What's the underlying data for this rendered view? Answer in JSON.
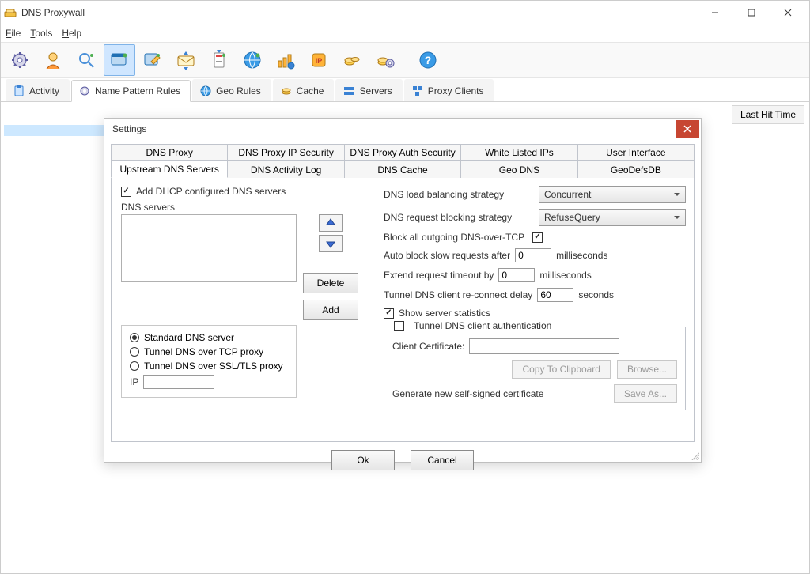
{
  "window": {
    "title": "DNS Proxywall",
    "minimize_icon": "minimize-icon",
    "maximize_icon": "maximize-icon",
    "close_icon": "close-icon"
  },
  "menubar": {
    "file": "File",
    "tools": "Tools",
    "help": "Help"
  },
  "main_tabs": {
    "activity": "Activity",
    "name_pattern_rules": "Name Pattern Rules",
    "geo_rules": "Geo Rules",
    "cache": "Cache",
    "servers": "Servers",
    "proxy_clients": "Proxy Clients"
  },
  "columns": {
    "last_hit_time": "Last Hit Time"
  },
  "dialog": {
    "title": "Settings",
    "tabs_row1": {
      "dns_proxy": "DNS Proxy",
      "dns_proxy_ip_sec": "DNS Proxy IP Security",
      "dns_proxy_auth_sec": "DNS Proxy Auth Security",
      "white_listed_ips": "White Listed IPs",
      "user_interface": "User Interface"
    },
    "tabs_row2": {
      "upstream": "Upstream DNS Servers",
      "activity_log": "DNS Activity Log",
      "dns_cache": "DNS Cache",
      "geo_dns": "Geo DNS",
      "geodefsdb": "GeoDefsDB"
    },
    "left": {
      "add_dhcp": "Add DHCP configured DNS servers",
      "dns_servers_label": "DNS servers",
      "delete": "Delete",
      "add": "Add",
      "radio_std": "Standard DNS server",
      "radio_tcp": "Tunnel DNS over TCP proxy",
      "radio_ssl": "Tunnel DNS over SSL/TLS proxy",
      "ip_label": "IP"
    },
    "right": {
      "load_bal_label": "DNS load balancing strategy",
      "load_bal_value": "Concurrent",
      "block_strat_label": "DNS request blocking strategy",
      "block_strat_value": "RefuseQuery",
      "block_tcp_label": "Block all outgoing DNS-over-TCP",
      "auto_block_label_pre": "Auto block slow requests after",
      "auto_block_value": "0",
      "ms_label": "milliseconds",
      "extend_label_pre": "Extend request timeout by",
      "extend_value": "0",
      "tunnel_delay_pre": "Tunnel DNS client re-connect delay",
      "tunnel_delay_value": "60",
      "seconds_label": "seconds",
      "show_stats": "Show server statistics",
      "tunnel_auth_legend": "Tunnel DNS client authentication",
      "client_cert_label": "Client Certificate:",
      "copy_btn": "Copy To Clipboard",
      "browse_btn": "Browse...",
      "gen_cert_label": "Generate new self-signed certificate",
      "save_as_btn": "Save As..."
    },
    "ok": "Ok",
    "cancel": "Cancel"
  }
}
